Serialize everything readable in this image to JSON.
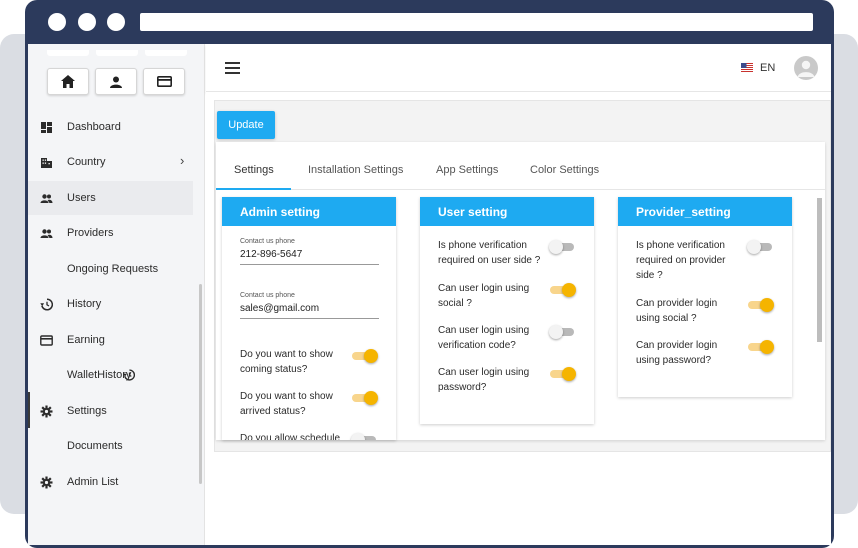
{
  "topbar": {
    "language": "EN"
  },
  "sidebar": {
    "items": [
      {
        "label": "Dashboard",
        "icon": "dashboard-icon"
      },
      {
        "label": "Country",
        "icon": "building-icon"
      },
      {
        "label": "Users",
        "icon": "users-icon"
      },
      {
        "label": "Providers",
        "icon": "providers-icon"
      },
      {
        "label": "Ongoing Requests",
        "icon": ""
      },
      {
        "label": "History",
        "icon": "history-icon"
      },
      {
        "label": "Earning",
        "icon": "card-icon"
      },
      {
        "label": "WalletHistory",
        "icon": ""
      },
      {
        "label": "Settings",
        "icon": "gear-icon"
      },
      {
        "label": "Documents",
        "icon": ""
      },
      {
        "label": "Admin List",
        "icon": "gear-icon"
      }
    ]
  },
  "main": {
    "update_label": "Update",
    "tabs": [
      {
        "label": "Settings"
      },
      {
        "label": "Installation Settings"
      },
      {
        "label": "App Settings"
      },
      {
        "label": "Color Settings"
      }
    ],
    "admin": {
      "title": "Admin setting",
      "fields": [
        {
          "label": "Contact us phone",
          "value": "212-896-5647"
        },
        {
          "label": "Contact us phone",
          "value": "sales@gmail.com"
        }
      ],
      "toggles": [
        {
          "label": "Do you want to show coming status?",
          "on": true
        },
        {
          "label": "Do you want to show arrived status?",
          "on": true
        },
        {
          "label": "Do you allow schedule",
          "on": false
        }
      ]
    },
    "user": {
      "title": "User setting",
      "toggles": [
        {
          "label": "Is phone verification required on user side ?",
          "on": false
        },
        {
          "label": "Can user login using social ?",
          "on": true
        },
        {
          "label": "Can user login using verification code?",
          "on": false
        },
        {
          "label": "Can user login using password?",
          "on": true
        }
      ]
    },
    "provider": {
      "title": "Provider_setting",
      "toggles": [
        {
          "label": "Is phone verification required on provider side ?",
          "on": false
        },
        {
          "label": "Can provider login using social ?",
          "on": true
        },
        {
          "label": "Can provider login using password?",
          "on": true
        }
      ]
    }
  },
  "colors": {
    "accent": "#1eaaf1",
    "toggle_on": "#f5b400",
    "frame": "#2c3a5c"
  }
}
